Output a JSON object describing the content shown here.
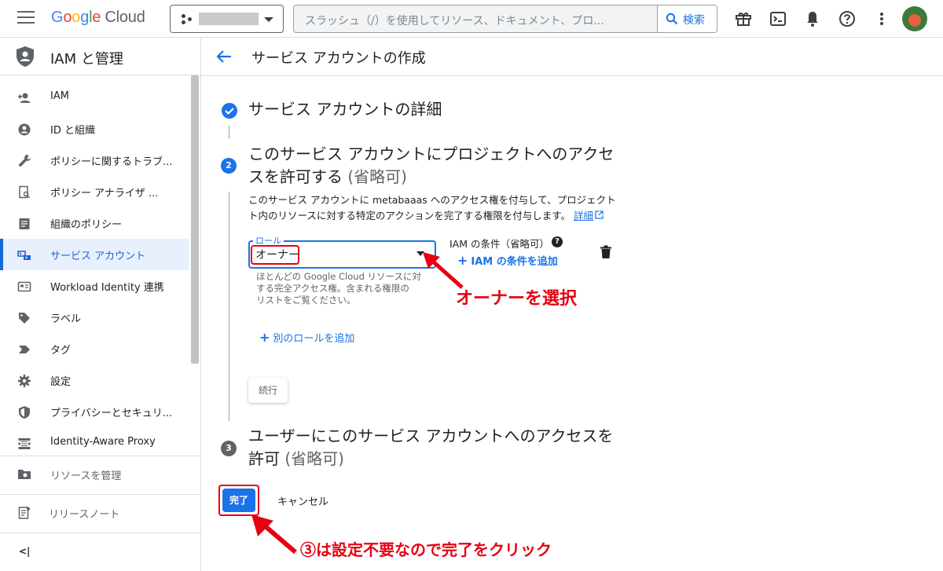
{
  "topbar": {
    "logo_letters": [
      "G",
      "o",
      "o",
      "g",
      "l",
      "e"
    ],
    "logo_product": "Cloud",
    "search_placeholder": "スラッシュ（/）を使用してリソース、ドキュメント、プロ...",
    "search_button": "検索"
  },
  "sidebar": {
    "title": "IAM と管理",
    "items": [
      {
        "label": "IAM",
        "icon": "person-add-icon"
      },
      {
        "label": "ID と組織",
        "icon": "account-circle-icon"
      },
      {
        "label": "ポリシーに関するトラブ...",
        "icon": "wrench-icon"
      },
      {
        "label": "ポリシー アナライザ ...",
        "icon": "policy-analyzer-icon"
      },
      {
        "label": "組織のポリシー",
        "icon": "document-icon"
      },
      {
        "label": "サービス アカウント",
        "icon": "service-account-icon",
        "active": true
      },
      {
        "label": "Workload Identity 連携",
        "icon": "id-card-icon"
      },
      {
        "label": "ラベル",
        "icon": "label-icon"
      },
      {
        "label": "タグ",
        "icon": "tag-icon"
      },
      {
        "label": "設定",
        "icon": "gear-icon"
      },
      {
        "label": "プライバシーとセキュリ...",
        "icon": "shield-icon"
      },
      {
        "label": "Identity-Aware Proxy",
        "icon": "proxy-icon"
      }
    ],
    "manage_resources": "リソースを管理",
    "release_notes": "リリースノート",
    "collapse": "<|"
  },
  "main": {
    "page_title": "サービス アカウントの作成",
    "step1": {
      "title": "サービス アカウントの詳細"
    },
    "step2": {
      "number": "2",
      "title_line1": "このサービス アカウントにプロジェクトへのアクセ",
      "title_line2": "スを許可する",
      "optional": "(省略可)",
      "desc_line1": "このサービス アカウントに metabaaas へのアクセス権を付与して、プロジェクト",
      "desc_line2": "ト内のリソースに対する特定のアクションを完了する権限を付与します。",
      "details_link": "詳細",
      "role_label": "ロール",
      "role_value": "オーナー",
      "role_help_line1": "ほとんどの Google Cloud リソースに対",
      "role_help_line2": "する完全アクセス権。含まれる権限の",
      "role_help_line3": "リストをご覧ください。",
      "iam_condition": "IAM の条件（省略可）",
      "add_condition": "IAM の条件を追加",
      "add_role": "別のロールを追加",
      "continue": "続行"
    },
    "step3": {
      "number": "3",
      "title_line1": "ユーザーにこのサービス アカウントへのアクセスを",
      "title_line2": "許可",
      "optional": "(省略可)"
    },
    "done": "完了",
    "cancel": "キャンセル"
  },
  "annotations": {
    "select_owner": "オーナーを選択",
    "click_done": "③は設定不要なので完了をクリック"
  },
  "colors": {
    "accent": "#1a73e8",
    "annotation": "#e60012"
  }
}
